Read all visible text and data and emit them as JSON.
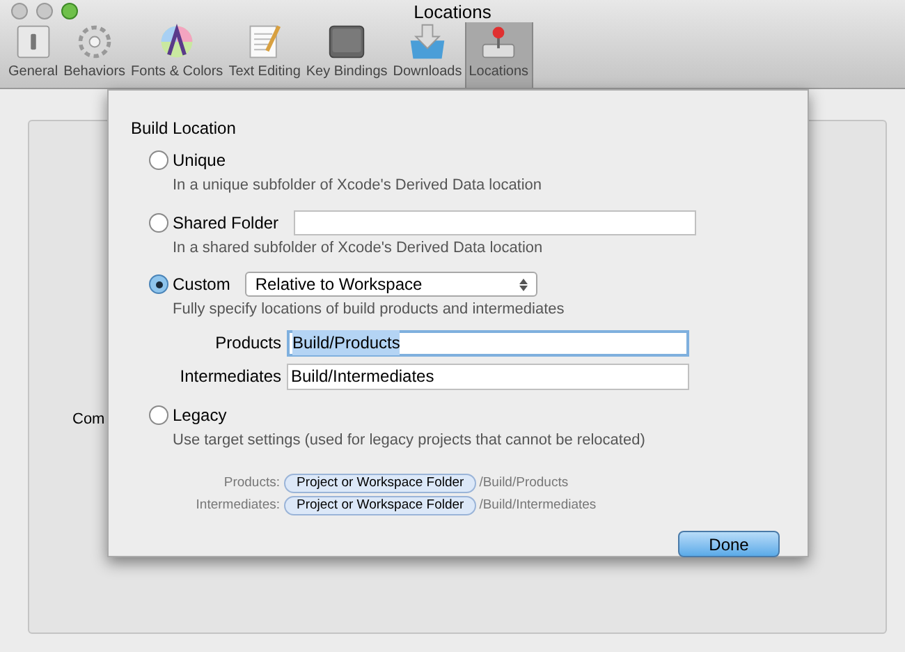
{
  "window": {
    "title": "Locations"
  },
  "toolbar": [
    {
      "label": "General",
      "kind": "general",
      "selected": false
    },
    {
      "label": "Behaviors",
      "kind": "gear",
      "selected": false
    },
    {
      "label": "Fonts & Colors",
      "kind": "fonts",
      "selected": false
    },
    {
      "label": "Text Editing",
      "kind": "text",
      "selected": false
    },
    {
      "label": "Key Bindings",
      "kind": "key",
      "selected": false
    },
    {
      "label": "Downloads",
      "kind": "download",
      "selected": false
    },
    {
      "label": "Locations",
      "kind": "joystick",
      "selected": true
    }
  ],
  "background": {
    "label": "Com"
  },
  "sheet": {
    "heading": "Build Location",
    "options": [
      {
        "label": "Unique",
        "kind": "plain",
        "selected": false,
        "description": "In a unique subfolder of Xcode's Derived Data location"
      },
      {
        "label": "Shared Folder",
        "kind": "field",
        "selected": false,
        "description": "In a shared subfolder of Xcode's Derived Data location"
      },
      {
        "label": "Custom",
        "kind": "popup",
        "selected": true,
        "popup": "Relative to Workspace",
        "description": "Fully specify locations of build products and intermediates",
        "fields": [
          {
            "label": "Products",
            "value": "Build/Products",
            "focused": true
          },
          {
            "label": "Intermediates",
            "value": "Build/Intermediates",
            "focused": false
          }
        ]
      },
      {
        "label": "Legacy",
        "kind": "plain",
        "selected": false,
        "description": "Use target settings (used for legacy projects that cannot be relocated)"
      }
    ],
    "paths": [
      {
        "label": "Products:",
        "token": "Project or Workspace Folder",
        "suffix": "/Build/Products"
      },
      {
        "label": "Intermediates:",
        "token": "Project or Workspace Folder",
        "suffix": "/Build/Intermediates"
      }
    ],
    "done": "Done"
  }
}
